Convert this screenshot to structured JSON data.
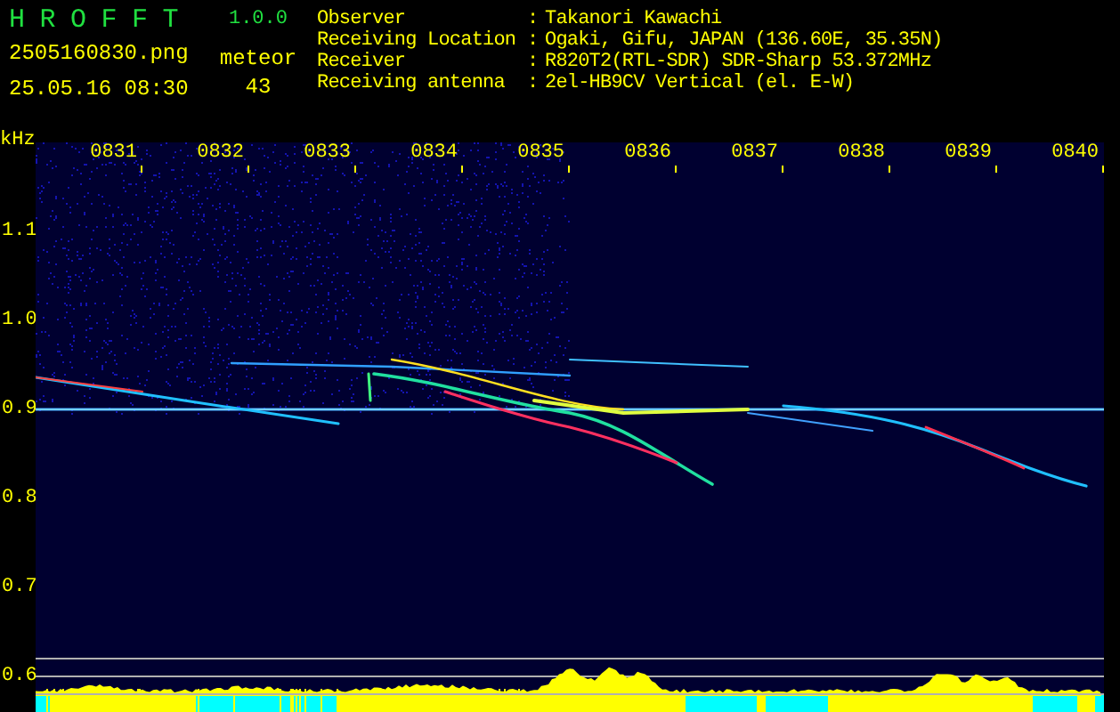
{
  "header": {
    "title": "HROFFT",
    "version": "1.0.0",
    "filename": "2505160830.png",
    "datetime": "25.05.16 08:30",
    "count_label": "meteor",
    "count": "43"
  },
  "station_info": [
    {
      "label": "Observer",
      "separator": ":",
      "value": "Takanori Kawachi"
    },
    {
      "label": "Receiving Location",
      "separator": ":",
      "value": "Ogaki, Gifu, JAPAN (136.60E, 35.35N)"
    },
    {
      "label": "Receiver",
      "separator": ":",
      "value": "R820T2(RTL-SDR) SDR-Sharp 53.372MHz"
    },
    {
      "label": "Receiving antenna",
      "separator": ":",
      "value": "2el-HB9CV Vertical (el. E-W)"
    }
  ],
  "spectrogram": {
    "unit": "kHz",
    "time_labels": [
      "0831",
      "0832",
      "0833",
      "0834",
      "0835",
      "0836",
      "0837",
      "0838",
      "0839",
      "0840"
    ],
    "frequency_labels": [
      "1.1",
      "1.0",
      "0.9",
      "0.8",
      "0.7",
      "0.6"
    ]
  }
}
